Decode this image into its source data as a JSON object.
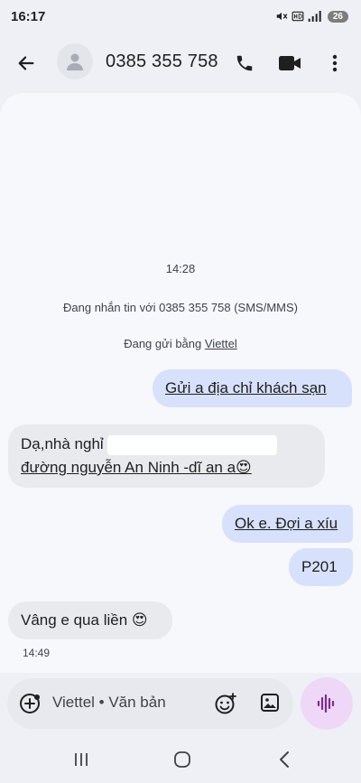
{
  "status_bar": {
    "time": "16:17",
    "battery": "26",
    "icons": [
      "mute-icon",
      "hd-icon",
      "signal-icon",
      "battery-icon"
    ]
  },
  "header": {
    "title": "0385 355 758",
    "icons": [
      "back-arrow-icon",
      "avatar-person-icon",
      "phone-icon",
      "video-call-icon",
      "more-vert-icon"
    ]
  },
  "conversation": {
    "timestamp": "14:28",
    "info_line": "Đang nhắn tin với 0385 355 758 (SMS/MMS)",
    "sending_prefix": "Đang gửi bằng",
    "sending_carrier": "Viettel",
    "messages": [
      {
        "direction": "outgoing",
        "text": "Gửi a địa chỉ khách sạn"
      },
      {
        "direction": "incoming",
        "line1": "Dạ,nhà nghỉ",
        "line2": "đường nguyễn An Ninh -dĩ an a😍"
      },
      {
        "direction": "outgoing",
        "text": "Ok e. Đợi a xíu"
      },
      {
        "direction": "outgoing",
        "text": "P201"
      },
      {
        "direction": "incoming",
        "text": "Vâng e qua liền 😍"
      }
    ],
    "last_time": "14:49"
  },
  "compose": {
    "placeholder": "Viettel • Văn bản",
    "icons": [
      "add-icon",
      "emoji-icon",
      "gallery-icon",
      "voice-input-icon"
    ]
  },
  "nav_bar": {
    "icons": [
      "recent-apps-icon",
      "home-icon",
      "nav-back-icon"
    ]
  },
  "colors": {
    "background": "#eef0f6",
    "chat_panel": "#f7f8fc",
    "outgoing_bubble": "#d8e1fb",
    "incoming_bubble": "#e9eaee",
    "voice_button": "#efd7f7",
    "voice_icon": "#7a2f8f"
  }
}
